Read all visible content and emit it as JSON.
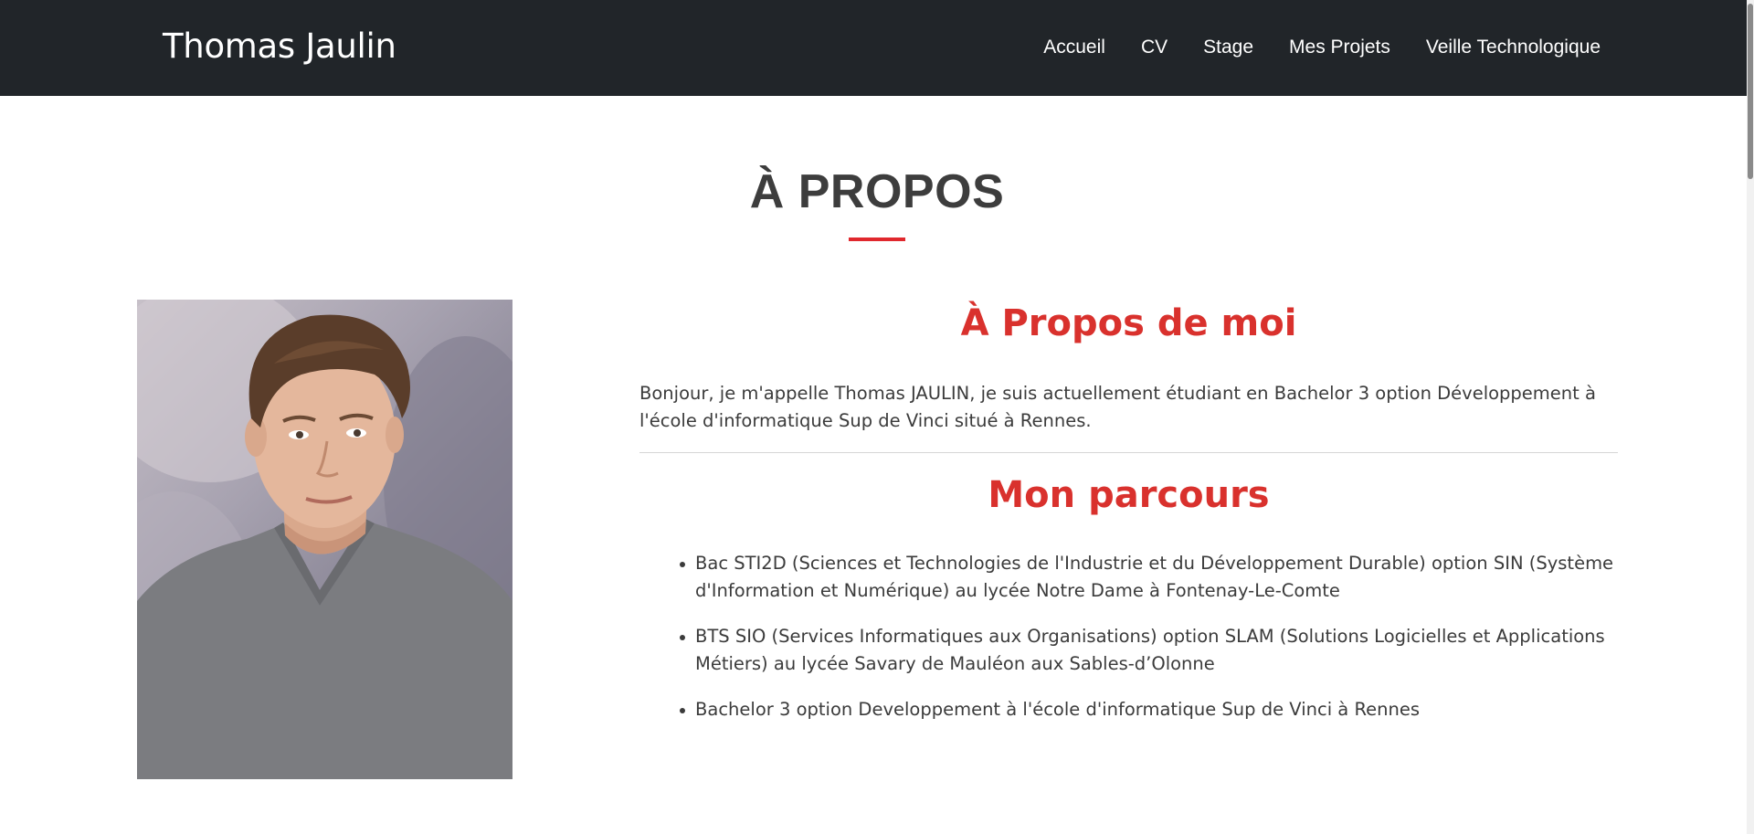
{
  "navbar": {
    "brand": "Thomas Jaulin",
    "links": [
      "Accueil",
      "CV",
      "Stage",
      "Mes Projets",
      "Veille Technologique"
    ]
  },
  "about_section": {
    "title": "À PROPOS",
    "accent_color": "#e0282d"
  },
  "about_me": {
    "heading": "À Propos de moi",
    "intro": "Bonjour, je m'appelle Thomas JAULIN, je suis actuellement étudiant en Bachelor 3 option Développement à l'école d'informatique Sup de Vinci situé à Rennes."
  },
  "parcours": {
    "heading": "Mon parcours",
    "items": [
      "Bac STI2D (Sciences et Technologies de l'Industrie et du Développement Durable) option SIN (Système d'Information et Numérique) au lycée Notre Dame à Fontenay-Le-Comte",
      "BTS SIO (Services Informatiques aux Organisations) option SLAM (Solutions Logicielles et Applications Métiers) au lycée Savary de Mauléon aux Sables-d’Olonne",
      "Bachelor 3 option Developpement à l'école d'informatique Sup de Vinci à Rennes"
    ]
  },
  "colors": {
    "navbar_bg": "#212529",
    "heading_red": "#d9312d",
    "text": "#3b3b3b"
  }
}
